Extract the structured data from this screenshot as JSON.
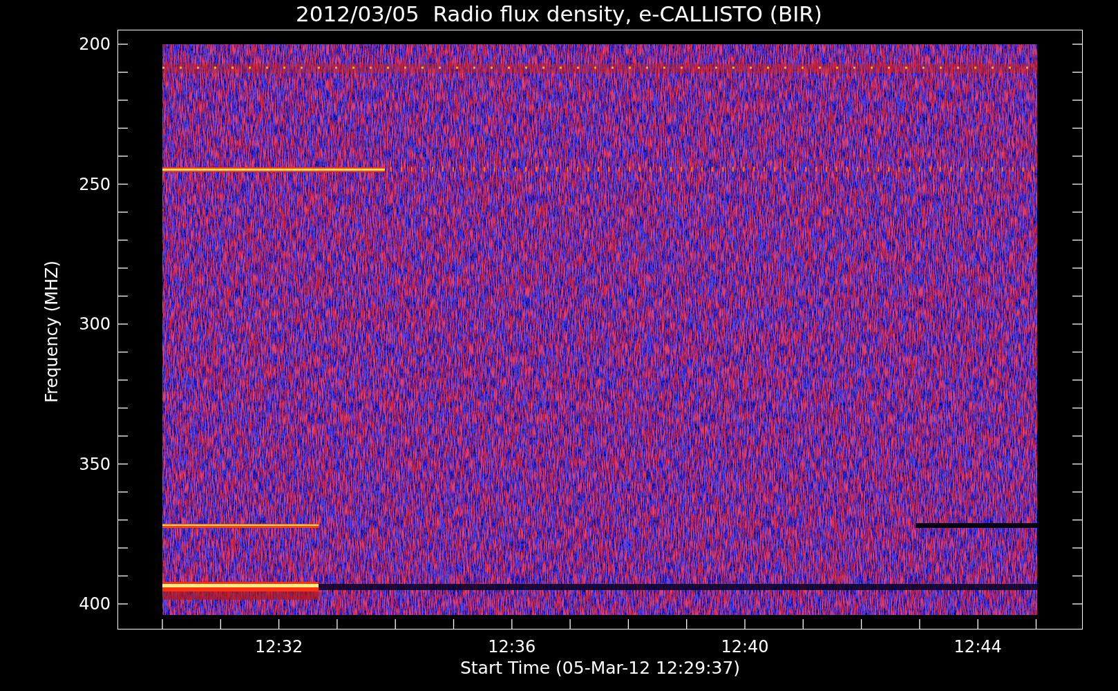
{
  "title": "2012/03/05  Radio flux density, e-CALLISTO (BIR)",
  "chart": {
    "ylabel": "Frequency (MHZ)",
    "xlabel": "Start Time (05-Mar-12 12:29:37)",
    "yticks": [
      "200",
      "250",
      "300",
      "350",
      "400"
    ],
    "xticks": [
      "12:32",
      "12:36",
      "12:40",
      "12:44"
    ]
  }
}
